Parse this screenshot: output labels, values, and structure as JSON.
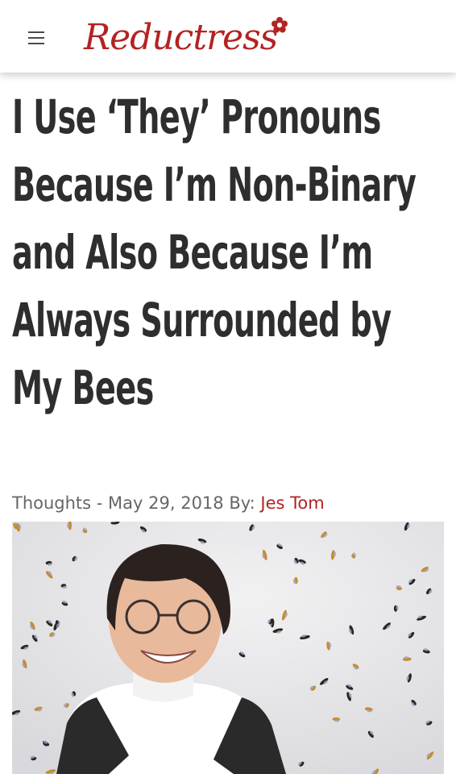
{
  "header": {
    "menu_icon": "hamburger-menu-icon",
    "logo_text": "Reductress",
    "logo_icon": "flower-icon",
    "brand_color": "#b22322"
  },
  "article": {
    "title": "I Use ‘They’ Pronouns Because I’m Non-Binary and Also Because I’m Always Surrounded by My Bees",
    "category": "Thoughts",
    "separator": " - ",
    "date": "May 29, 2018",
    "by_label": " By: ",
    "author": "Jes Tom",
    "image_icon": "person-with-bees-photo"
  },
  "colors": {
    "headline": "#2e2e2e",
    "meta": "#666666",
    "accent": "#b22322"
  }
}
